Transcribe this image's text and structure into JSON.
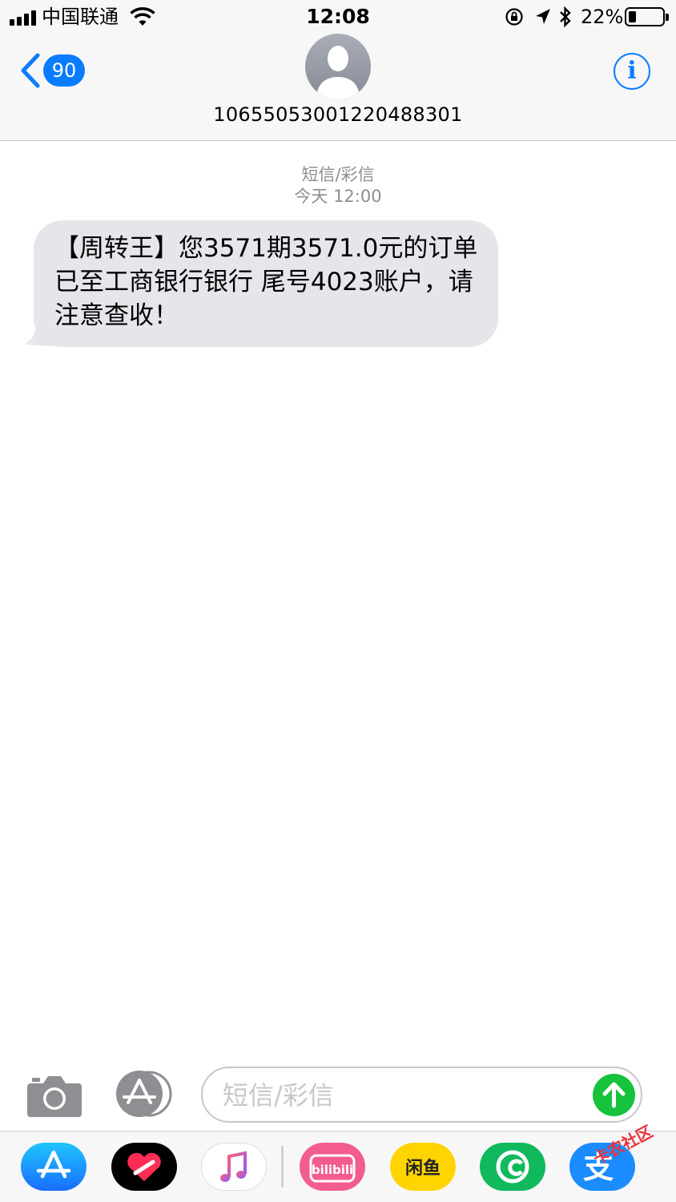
{
  "status_bar": {
    "carrier": "中国联通",
    "time": "12:08",
    "battery_percent_label": "22%",
    "battery_level": 0.22,
    "icons": [
      "signal-icon",
      "wifi-icon",
      "orientation-lock-icon",
      "location-icon",
      "bluetooth-icon",
      "battery-icon"
    ]
  },
  "nav": {
    "back_count": "90",
    "contact_number": "10655053001220488301",
    "info_symbol": "i"
  },
  "conversation": {
    "message_type": "短信/彩信",
    "timestamp": "今天 12:00",
    "messages": [
      {
        "direction": "incoming",
        "text": "【周转王】您3571期3571.0元的订单已至工商银行银行 尾号4023账户，请注意查收！"
      }
    ]
  },
  "composer": {
    "placeholder": "短信/彩信",
    "icons": [
      "camera-icon",
      "app-store-icon",
      "send-arrow-icon"
    ]
  },
  "app_drawer": {
    "apps": [
      {
        "name": "app-store",
        "icon": "app-store-icon",
        "color": "#1a8cff"
      },
      {
        "name": "digital-touch",
        "icon": "heart-icon",
        "color": "#000000"
      },
      {
        "name": "music",
        "icon": "music-note-icon",
        "color": "#ffffff"
      },
      {
        "name": "bilibili",
        "icon": "bilibili-icon",
        "color": "#f25d8e",
        "label": "bilibili"
      },
      {
        "name": "xianyu",
        "icon": "xianyu-icon",
        "color": "#ffd400",
        "label": "闲鱼"
      },
      {
        "name": "green-app",
        "icon": "chat-bubble-icon",
        "color": "#0fb95c"
      },
      {
        "name": "alipay",
        "icon": "alipay-icon",
        "color": "#1a8cff",
        "label": "支"
      },
      {
        "name": "red-app",
        "icon": "red-app-icon",
        "color": "#e8333a"
      }
    ]
  },
  "watermark": "卡农社区"
}
